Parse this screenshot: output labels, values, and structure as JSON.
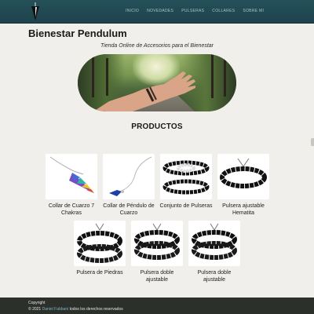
{
  "header": {
    "nav": [
      "INICIO",
      "NOVEDADES",
      "PULSERAS",
      "COLLARES",
      "SOBRE MI"
    ]
  },
  "site": {
    "title": "Bienestar Pendulum",
    "tagline": "Tienda Online de Accesorios para el Bienestar"
  },
  "products_section": {
    "title": "PRODUCTOS",
    "items": [
      {
        "name": "Collar de Cuarzo 7 Chakras"
      },
      {
        "name": "Collar de Péndulo de Cuarzo"
      },
      {
        "name": "Conjunto de Pulseras"
      },
      {
        "name": "Pulsera ajustable Hematita"
      },
      {
        "name": "Pulsera de Piedras"
      },
      {
        "name": "Pulsera doble ajustable"
      },
      {
        "name": "Pulsera doble ajustable"
      }
    ]
  },
  "footer": {
    "copyright_label": "Copyright",
    "year_line": "© 2021",
    "author": "Daniel Fabbani",
    "rights": "todos los derechos reservados"
  },
  "colors": {
    "header_bg": "#24505a",
    "nav_text": "#a8c4c8",
    "page_bg": "#f1efeb",
    "footer_bg": "#2c302b",
    "author_link": "#7fb0c4"
  }
}
